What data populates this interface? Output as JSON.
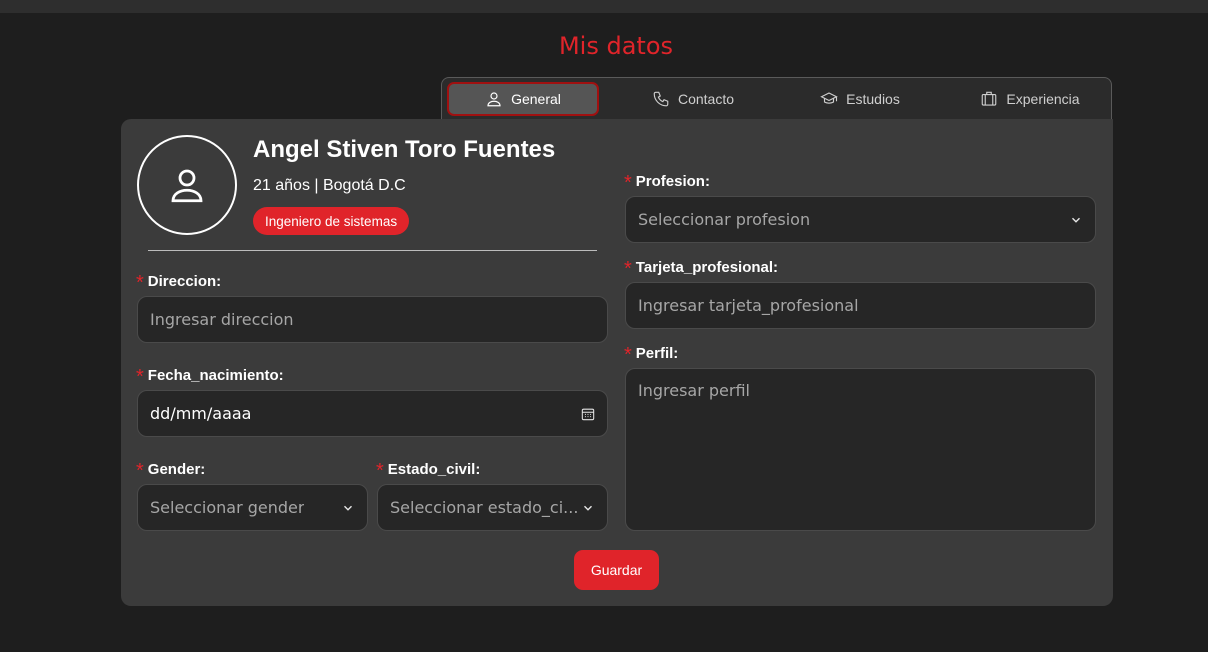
{
  "page": {
    "title": "Mis datos"
  },
  "tabs": [
    {
      "label": "General",
      "icon": "user-icon",
      "active": true
    },
    {
      "label": "Contacto",
      "icon": "phone-icon"
    },
    {
      "label": "Estudios",
      "icon": "graduation-cap-icon"
    },
    {
      "label": "Experiencia",
      "icon": "briefcase-icon"
    }
  ],
  "profile": {
    "name": "Angel Stiven Toro Fuentes",
    "meta": "21 años | Bogotá D.C",
    "badge": "Ingeniero de sistemas",
    "avatar_icon": "user-icon"
  },
  "form": {
    "direccion": {
      "label": "Direccion:",
      "placeholder": "Ingresar direccion"
    },
    "fecha_nacimiento": {
      "label": "Fecha_nacimiento:",
      "value": "dd/mm/aaaa",
      "icon": "calendar-icon"
    },
    "gender": {
      "label": "Gender:",
      "placeholder": "Seleccionar gender"
    },
    "estado_civil": {
      "label": "Estado_civil:",
      "placeholder": "Seleccionar estado_ci..."
    },
    "profesion": {
      "label": "Profesion:",
      "placeholder": "Seleccionar profesion"
    },
    "tarjeta_profesional": {
      "label": "Tarjeta_profesional:",
      "placeholder": "Ingresar tarjeta_profesional"
    },
    "perfil": {
      "label": "Perfil:",
      "placeholder": "Ingresar perfil"
    },
    "required_mark": "*",
    "save_label": "Guardar"
  },
  "colors": {
    "accent": "#e0242a",
    "background": "#1e1e1e",
    "card": "#3b3b3b",
    "field": "#262626"
  }
}
